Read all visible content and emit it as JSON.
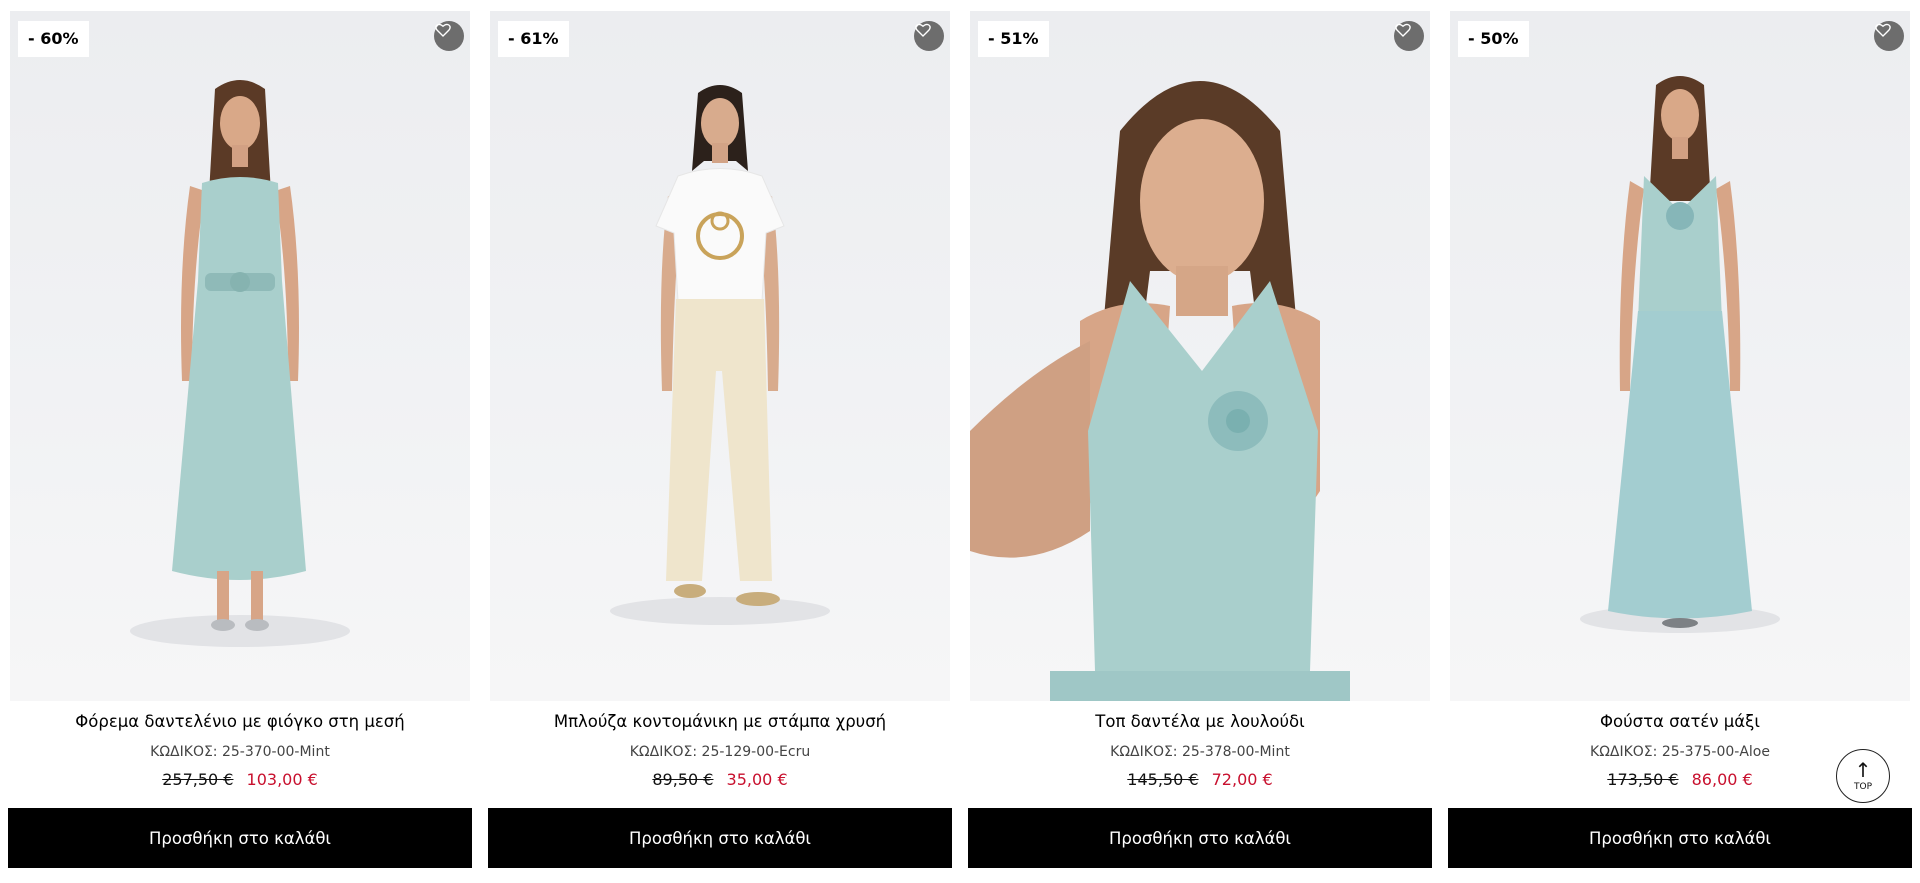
{
  "products": [
    {
      "discount": "- 60%",
      "name": "Φόρεμα δαντελένιο με φιόγκο στη μεσή",
      "code": "ΚΩΔΙΚΟΣ: 25-370-00-Mint",
      "old_price": "257,50 €",
      "new_price": "103,00 €",
      "button": "Προσθήκη στο καλάθι",
      "garment_color": "#a9cfcc"
    },
    {
      "discount": "- 61%",
      "name": "Μπλούζα κοντομάνικη με στάμπα χρυσή",
      "code": "ΚΩΔΙΚΟΣ: 25-129-00-Ecru",
      "old_price": "89,50 €",
      "new_price": "35,00 €",
      "button": "Προσθήκη στο καλάθι",
      "garment_color": "#efe5cc"
    },
    {
      "discount": "- 51%",
      "name": "Τοπ δαντέλα με λουλούδι",
      "code": "ΚΩΔΙΚΟΣ: 25-378-00-Mint",
      "old_price": "145,50 €",
      "new_price": "72,00 €",
      "button": "Προσθήκη στο καλάθι",
      "garment_color": "#a9cfcc"
    },
    {
      "discount": "- 50%",
      "name": "Φούστα σατέν μάξι",
      "code": "ΚΩΔΙΚΟΣ: 25-375-00-Aloe",
      "old_price": "173,50 €",
      "new_price": "86,00 €",
      "button": "Προσθήκη στο καλάθι",
      "garment_color": "#a3cdd0"
    }
  ],
  "top_button": {
    "label": "TOP",
    "icon": "arrow-up-icon"
  },
  "icons": {
    "wishlist": "heart-icon"
  },
  "colors": {
    "sale_price": "#c8102e",
    "button_bg": "#000000",
    "wishlist_bg": "#6d6d6d"
  }
}
